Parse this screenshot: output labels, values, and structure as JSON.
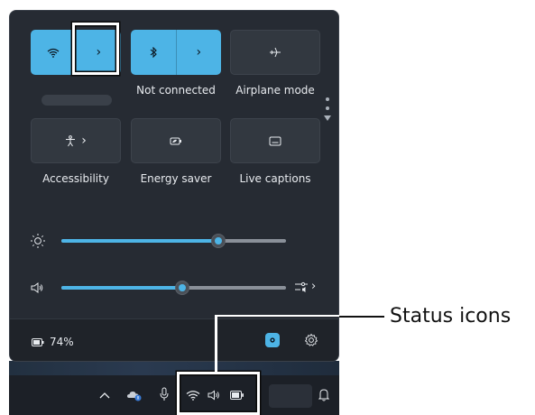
{
  "quick_settings": {
    "tiles_row1": [
      {
        "name": "wifi",
        "icon": "wifi-icon",
        "state": "on",
        "chevron": "›",
        "label": ""
      },
      {
        "name": "bluetooth",
        "icon": "bluetooth-icon",
        "state": "on",
        "chevron": "›",
        "label": "Not connected"
      },
      {
        "name": "airplane",
        "icon": "airplane-icon",
        "state": "off",
        "label": "Airplane mode"
      }
    ],
    "tiles_row2": [
      {
        "name": "accessibility",
        "icon": "accessibility-icon",
        "chevron": "›",
        "label": "Accessibility"
      },
      {
        "name": "energy-saver",
        "icon": "energy-saver-icon",
        "label": "Energy saver"
      },
      {
        "name": "live-captions",
        "icon": "live-captions-icon",
        "label": "Live captions"
      }
    ],
    "brightness": {
      "icon": "brightness-icon",
      "level_percent": 70
    },
    "volume": {
      "icon": "speaker-icon",
      "level_percent": 54,
      "output_icon": "audio-output-icon",
      "output_chevron": "›"
    },
    "footer": {
      "battery_icon": "battery-icon",
      "battery_text": "74%",
      "edit_icon": "pencil-edit-icon",
      "settings_icon": "gear-icon"
    }
  },
  "taskbar": {
    "icons": [
      "chevron-up-icon",
      "onedrive-icon",
      "microphone-icon",
      "wifi-icon",
      "speaker-icon",
      "battery-icon",
      "bell-icon"
    ]
  },
  "callout": {
    "text": "Status icons"
  },
  "colors": {
    "accent": "#4db4e6",
    "panel": "#262b33",
    "highlight_box": "#ffffff"
  }
}
